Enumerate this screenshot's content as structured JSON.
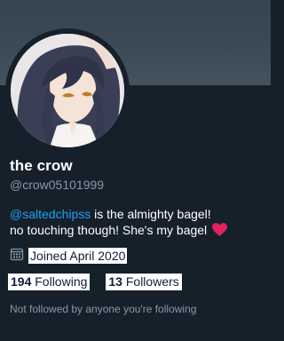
{
  "profile": {
    "display_name": "the crow",
    "handle": "@crow05101999",
    "bio": {
      "mention": "@saltedchipss",
      "line1_rest": " is the almighty bagel!",
      "line2": "no touching though! She's my bagel"
    },
    "joined": "Joined April 2020",
    "following_count": "194",
    "following_label": " Following",
    "followers_count": "13",
    "followers_label": " Followers",
    "followed_by_note": "Not followed by anyone you're following"
  },
  "icons": {
    "calendar": "calendar-icon",
    "heart": "heart-icon"
  },
  "colors": {
    "background": "#15202b",
    "mention": "#1da1f2",
    "muted": "#8899a6",
    "heart": "#e0245e"
  }
}
